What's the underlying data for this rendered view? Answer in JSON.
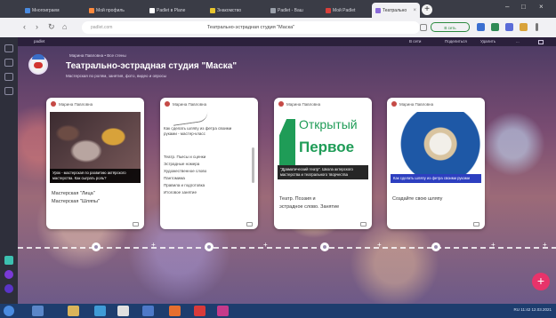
{
  "browser": {
    "tabs": [
      {
        "label": "Многоиграем",
        "color": "#4a8be0"
      },
      {
        "label": "Мой профиль",
        "color": "#ff8a3d"
      },
      {
        "label": "Padlet в Plane",
        "color": "#ffffff"
      },
      {
        "label": "Знакомство",
        "color": "#e8c52d"
      },
      {
        "label": "Padlet - Ваш",
        "color": "#9aa0aa"
      },
      {
        "label": "Мой Padlet",
        "color": "#d9403b"
      },
      {
        "label": "Театрально",
        "color": "#8a6ad9"
      }
    ],
    "newtab": "+",
    "window_controls": [
      "–",
      "□",
      "×"
    ],
    "address": {
      "domain": "padlet.com",
      "title": "Театрально-эстрадная студия \"Маска\"",
      "pill": "В сеть"
    },
    "nav": [
      "‹",
      "›",
      "↻",
      "⌂"
    ]
  },
  "board": {
    "top_labels": [
      "padlet",
      "В сети",
      "Поделиться",
      "Удалить",
      "..."
    ],
    "crumb": "Марина Павловна • Все стены",
    "title": "Театрально-эстрадная студия \"Маска\"",
    "subtitle": "Мастерская по ролям, занятия, фото, видео и опросы",
    "cards": [
      {
        "author": "Марина Павловна",
        "caption": "Урок - мастерская по развитию актёрского мастерства. Как сыграть роль?",
        "text": [
          "Мастерская \"Лица\"",
          "Мастерская \"Шляпы\""
        ]
      },
      {
        "author": "Марина Павловна",
        "doc_lines": [
          "Как сделать шляпу из фетра своими",
          "руками - мастер-класс",
          "",
          "Театр. Пьесы и сценки",
          "Эстрадные номера",
          "Художественное слово",
          "Пантомима",
          "Правила и подготовка",
          "Итоговое занятие"
        ],
        "text": []
      },
      {
        "author": "Марина Павловна",
        "logo": [
          "Открытый",
          "Первое"
        ],
        "caption": "\"Драматический театр\". Школа актерского мастерства и театрального творчества",
        "text": [
          "Театр. Поэзия и",
          "эстрадное слово. Занятие"
        ]
      },
      {
        "author": "Марина Павловна",
        "caption": "Как сделать шляпу из фетра своими руками",
        "text": [
          "Создайте свою шляпу"
        ]
      }
    ],
    "fab": "+",
    "timeline_plus": [
      "+",
      "+",
      "+",
      "+",
      "+"
    ]
  },
  "taskbar": {
    "tray": "RU  11:42  12.03.2021"
  }
}
